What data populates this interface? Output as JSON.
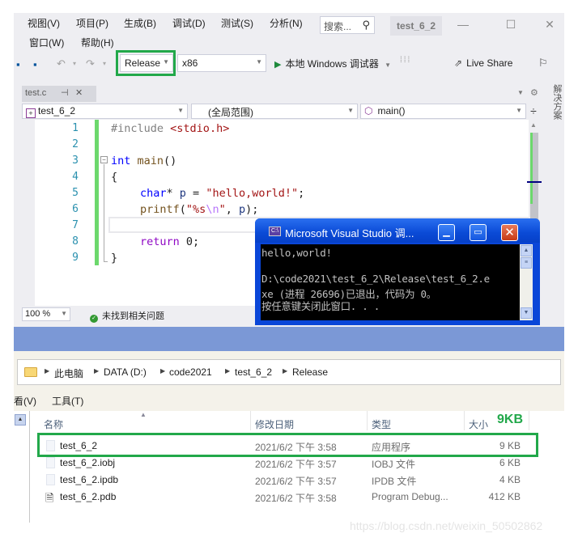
{
  "vs": {
    "menu": [
      "视图(V)",
      "项目(P)",
      "生成(B)",
      "调试(D)",
      "测试(S)",
      "分析(N)",
      "窗口(W)",
      "帮助(H)"
    ],
    "search_placeholder": "搜索...",
    "solution_title": "test_6_2",
    "window_controls": {
      "minimize": "—",
      "maximize": "☐",
      "close": "✕"
    },
    "toolbar": {
      "configuration": "Release",
      "platform": "x86",
      "run_label": "本地 Windows 调试器",
      "live_share": "Live Share"
    },
    "tab": {
      "label": "test.c",
      "pin": "⊣",
      "close": "✕"
    },
    "navbar": {
      "project": "test_6_2",
      "scope": "(全局范围)",
      "member": "main()"
    },
    "side_tab": "解决方案",
    "code": {
      "line_numbers": [
        "1",
        "2",
        "3",
        "4",
        "5",
        "6",
        "7",
        "8",
        "9"
      ],
      "lines": {
        "l1_directive": "#include",
        "l1_header": "<stdio.h>",
        "l3_type": "int",
        "l3_fn": "main",
        "l3_rest": "()",
        "l4": "{",
        "l5_type": "char",
        "l5_mid": "* ",
        "l5_var": "p",
        "l5_eq": " = ",
        "l5_str": "\"hello,world!\"",
        "l5_end": ";",
        "l6_fn": "printf",
        "l6_open": "(",
        "l6_str1": "\"%s",
        "l6_esc": "\\n",
        "l6_str2": "\"",
        "l6_sep": ", ",
        "l6_var": "p",
        "l6_end": ");",
        "l8_kw": "return",
        "l8_rest": " 0;",
        "l9": "}"
      }
    },
    "status": {
      "zoom": "100 %",
      "issues": "未找到相关问题"
    }
  },
  "console": {
    "title": "Microsoft Visual Studio 调...",
    "icon_text": "C:\\",
    "output": [
      "hello,world!",
      "",
      "D:\\code2021\\test_6_2\\Release\\test_6_2.e",
      "xe (进程 26696)已退出，代码为 0。",
      "按任意键关闭此窗口. . ."
    ]
  },
  "explorer": {
    "breadcrumb": [
      "此电脑",
      "DATA (D:)",
      "code2021",
      "test_6_2",
      "Release"
    ],
    "menu": [
      "看(V)",
      "工具(T)"
    ],
    "columns": {
      "name": "名称",
      "date": "修改日期",
      "type": "类型",
      "size": "大小"
    },
    "size_annotation": "9KB",
    "files": [
      {
        "name": "test_6_2",
        "date": "2021/6/2 下午 3:58",
        "type": "应用程序",
        "size": "9 KB",
        "icon": "exe-file-icon"
      },
      {
        "name": "test_6_2.iobj",
        "date": "2021/6/2 下午 3:57",
        "type": "IOBJ 文件",
        "size": "6 KB",
        "icon": "generic-file-icon"
      },
      {
        "name": "test_6_2.ipdb",
        "date": "2021/6/2 下午 3:57",
        "type": "IPDB 文件",
        "size": "4 KB",
        "icon": "generic-file-icon"
      },
      {
        "name": "test_6_2.pdb",
        "date": "2021/6/2 下午 3:58",
        "type": "Program Debug...",
        "size": "412 KB",
        "icon": "pdb-file-icon"
      }
    ]
  },
  "watermark": "https://blog.csdn.net/weixin_50502862",
  "colors": {
    "highlight": "#22a84a",
    "console_title": "#0a46d8",
    "line_number": "#2b91af"
  }
}
